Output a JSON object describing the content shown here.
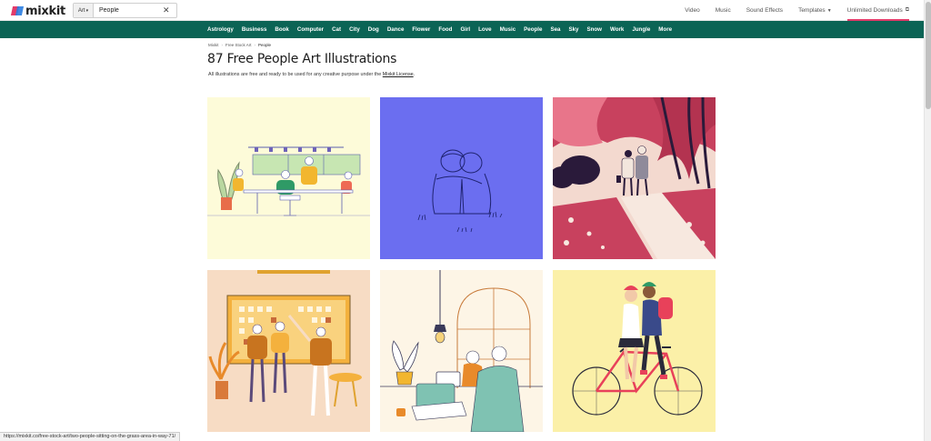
{
  "header": {
    "logo_text": "mixkit",
    "search": {
      "type_label": "Art",
      "value": "People"
    },
    "nav": [
      {
        "label": "Video"
      },
      {
        "label": "Music"
      },
      {
        "label": "Sound Effects"
      },
      {
        "label": "Templates"
      },
      {
        "label": "Unlimited Downloads"
      }
    ]
  },
  "categories": [
    "Astrology",
    "Business",
    "Book",
    "Computer",
    "Cat",
    "City",
    "Dog",
    "Dance",
    "Flower",
    "Food",
    "Girl",
    "Love",
    "Music",
    "People",
    "Sea",
    "Sky",
    "Snow",
    "Work",
    "Jungle",
    "More"
  ],
  "breadcrumb": [
    "Mixkit",
    "Free Stock Art",
    "People"
  ],
  "page": {
    "title": "87 Free People Art Illustrations",
    "subtitle_text": "All illustrations are free and ready to be used for any creative purpose under the",
    "license_link": "Mixkit License",
    "subtitle_end": "."
  },
  "gallery": [
    {
      "name": "office-meeting-illustration",
      "bg": "#fdfbd9"
    },
    {
      "name": "couple-hugging-illustration",
      "bg": "#6b6ef0"
    },
    {
      "name": "couple-walking-park-illustration",
      "bg": "#f3d9cf"
    },
    {
      "name": "team-high-five-illustration",
      "bg": "#f7dcc4"
    },
    {
      "name": "couple-working-laptop-illustration",
      "bg": "#fdf5e6"
    },
    {
      "name": "couple-on-bicycle-illustration",
      "bg": "#fbf0a8"
    }
  ],
  "status_url": "https://mixkit.co/free-stock-art/two-people-sitting-on-the-grass-area-in-way-71/"
}
